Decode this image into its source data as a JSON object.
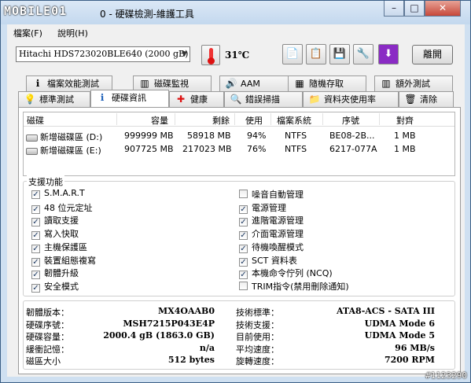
{
  "window": {
    "logo": "MOBILE01",
    "title": "0 - 硬碟檢測-維護工具",
    "controls": {
      "minimize": "–",
      "maximize": "□",
      "close": "✕"
    }
  },
  "menu": [
    {
      "label": "檔案(F)"
    },
    {
      "label": "說明(H)"
    }
  ],
  "toolbar": {
    "drive": "Hitachi HDS723020BLE640 (2000 gB)",
    "temperature": "31℃",
    "exit_label": "離開",
    "buttons": [
      {
        "name": "copy-icon",
        "glyph": "📄"
      },
      {
        "name": "copy-alt-icon",
        "glyph": "📋"
      },
      {
        "name": "save-icon",
        "glyph": "💾"
      },
      {
        "name": "settings-icon",
        "glyph": "🔧"
      },
      {
        "name": "download-icon",
        "glyph": "⬇"
      }
    ]
  },
  "tabs_back": [
    {
      "label": "檔案效能測試",
      "icon": "ℹ"
    },
    {
      "label": "磁碟監視",
      "icon": "▥"
    },
    {
      "label": "AAM",
      "icon": "🔊"
    },
    {
      "label": "隨機存取",
      "icon": "▦"
    },
    {
      "label": "額外測試",
      "icon": "▥"
    }
  ],
  "tabs_front": [
    {
      "label": "標準測試",
      "icon": "💡"
    },
    {
      "label": "硬碟資訊",
      "icon": "ℹ"
    },
    {
      "label": "健康",
      "icon": "✚"
    },
    {
      "label": "錯誤掃描",
      "icon": "🔍"
    },
    {
      "label": "資料夾使用率",
      "icon": "📁"
    },
    {
      "label": "清除",
      "icon": "🗑"
    }
  ],
  "volumes": {
    "headers": [
      "磁碟",
      "容量",
      "剩餘",
      "使用",
      "檔案系統",
      "序號",
      "對齊"
    ],
    "rows": [
      [
        "新增磁碟區 (D:)",
        "999999 MB",
        "58918 MB",
        "94%",
        "NTFS",
        "BE08-2B...",
        "1 MB"
      ],
      [
        "新增磁碟區 (E:)",
        "907725 MB",
        "217023 MB",
        "76%",
        "NTFS",
        "6217-077A",
        "1 MB"
      ]
    ]
  },
  "features": {
    "title": "支援功能",
    "left": [
      {
        "label": "S.M.A.R.T",
        "checked": true
      },
      {
        "label": "48 位元定址",
        "checked": true
      },
      {
        "label": "讀取支援",
        "checked": true
      },
      {
        "label": "寫入快取",
        "checked": true
      },
      {
        "label": "主機保護區",
        "checked": true
      },
      {
        "label": "裝置組態複寫",
        "checked": true
      },
      {
        "label": "韌體升級",
        "checked": true
      },
      {
        "label": "安全模式",
        "checked": true
      }
    ],
    "right": [
      {
        "label": "噪音自動管理",
        "checked": false
      },
      {
        "label": "電源管理",
        "checked": true
      },
      {
        "label": "進階電源管理",
        "checked": true
      },
      {
        "label": "介面電源管理",
        "checked": true
      },
      {
        "label": "待機喚醒模式",
        "checked": true
      },
      {
        "label": "SCT 資料表",
        "checked": true
      },
      {
        "label": "本機命令佇列 (NCQ)",
        "checked": true
      },
      {
        "label": "TRIM指令(禁用刪除通知)",
        "checked": false
      }
    ]
  },
  "info": {
    "left": [
      {
        "label": "韌體版本：",
        "value": "MX4OAAB0"
      },
      {
        "label": "硬碟序號：",
        "value": "MSH7215P043E4P"
      },
      {
        "label": "硬碟容量：",
        "value": "2000.4 gB (1863.0 GB)"
      },
      {
        "label": "緩衝記憶：",
        "value": "n/a"
      },
      {
        "label": "磁區大小",
        "value": "512 bytes"
      }
    ],
    "right": [
      {
        "label": "技術標準：",
        "value": "ATA8-ACS - SATA III"
      },
      {
        "label": "技術支援：",
        "value": "UDMA Mode 6"
      },
      {
        "label": "目前使用：",
        "value": "UDMA Mode 5"
      },
      {
        "label": "平均速度：",
        "value": "96 MB/s"
      },
      {
        "label": "旋轉速度：",
        "value": "7200 RPM"
      }
    ]
  },
  "watermark": "#1123290"
}
